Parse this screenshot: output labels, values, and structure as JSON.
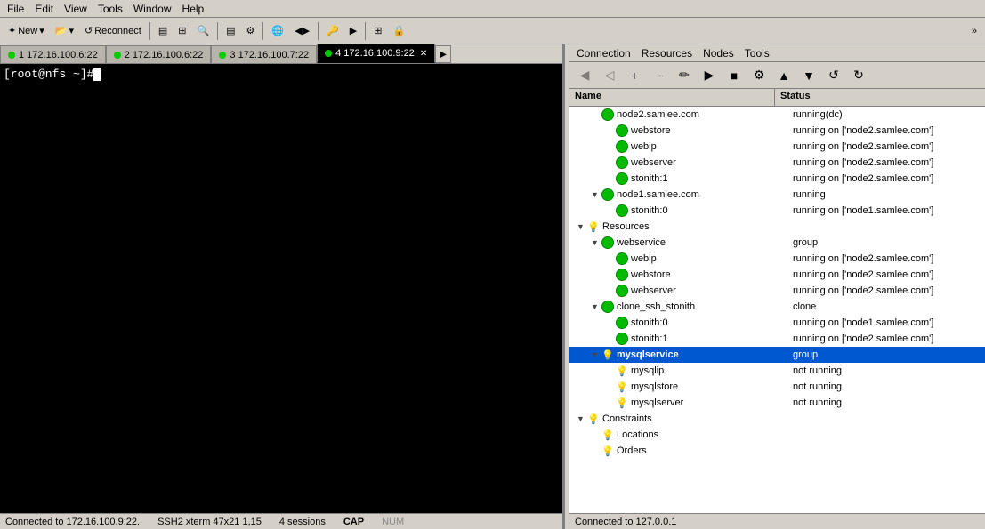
{
  "menubar": {
    "items": [
      "File",
      "Edit",
      "View",
      "Tools",
      "Window",
      "Help"
    ]
  },
  "toolbar": {
    "new_label": "New",
    "reconnect_label": "Reconnect"
  },
  "tabs": [
    {
      "id": 1,
      "label": "172.16.100.6:22",
      "active": false
    },
    {
      "id": 2,
      "label": "172.16.100.6:22",
      "active": false
    },
    {
      "id": 3,
      "label": "172.16.100.7:22",
      "active": false
    },
    {
      "id": 4,
      "label": "172.16.100.9:22",
      "active": true
    }
  ],
  "terminal": {
    "prompt": "[root@nfs ~]# "
  },
  "status_bar": {
    "connection": "Connected to 172.16.100.9:22.",
    "ssh_info": "SSH2  xterm  47x21  1,15",
    "sessions": "4 sessions",
    "cap": "CAP",
    "num": "NUM"
  },
  "cluster_menu": {
    "items": [
      "Connection",
      "Resources",
      "Nodes",
      "Tools"
    ]
  },
  "tree_headers": {
    "name": "Name",
    "status": "Status"
  },
  "tree_rows": [
    {
      "indent": 3,
      "icon": "green-circle",
      "expand": false,
      "name": "node2.samlee.com",
      "status": "running(dc)",
      "selected": false
    },
    {
      "indent": 4,
      "icon": "green-circle",
      "expand": false,
      "name": "webstore",
      "status": "running on ['node2.samlee.com']",
      "selected": false
    },
    {
      "indent": 4,
      "icon": "green-circle",
      "expand": false,
      "name": "webip",
      "status": "running on ['node2.samlee.com']",
      "selected": false
    },
    {
      "indent": 4,
      "icon": "green-circle",
      "expand": false,
      "name": "webserver",
      "status": "running on ['node2.samlee.com']",
      "selected": false
    },
    {
      "indent": 4,
      "icon": "green-circle",
      "expand": false,
      "name": "stonith:1",
      "status": "running on ['node2.samlee.com']",
      "selected": false
    },
    {
      "indent": 3,
      "icon": "green-circle",
      "expand": true,
      "name": "node1.samlee.com",
      "status": "running",
      "selected": false
    },
    {
      "indent": 4,
      "icon": "green-circle",
      "expand": false,
      "name": "stonith:0",
      "status": "running on ['node1.samlee.com']",
      "selected": false
    },
    {
      "indent": 2,
      "icon": "lightbulb",
      "expand": true,
      "name": "Resources",
      "status": "",
      "selected": false
    },
    {
      "indent": 3,
      "icon": "green-circle",
      "expand": true,
      "name": "webservice",
      "status": "group",
      "selected": false
    },
    {
      "indent": 4,
      "icon": "green-circle",
      "expand": false,
      "name": "webip",
      "status": "running on ['node2.samlee.com']",
      "selected": false
    },
    {
      "indent": 4,
      "icon": "green-circle",
      "expand": false,
      "name": "webstore",
      "status": "running on ['node2.samlee.com']",
      "selected": false
    },
    {
      "indent": 4,
      "icon": "green-circle",
      "expand": false,
      "name": "webserver",
      "status": "running on ['node2.samlee.com']",
      "selected": false
    },
    {
      "indent": 3,
      "icon": "green-circle",
      "expand": true,
      "name": "clone_ssh_stonith",
      "status": "clone",
      "selected": false
    },
    {
      "indent": 4,
      "icon": "green-circle",
      "expand": false,
      "name": "stonith:0",
      "status": "running on ['node1.samlee.com']",
      "selected": false
    },
    {
      "indent": 4,
      "icon": "green-circle",
      "expand": false,
      "name": "stonith:1",
      "status": "running on ['node2.samlee.com']",
      "selected": false
    },
    {
      "indent": 3,
      "icon": "lightbulb",
      "expand": true,
      "name": "mysqlservice",
      "status": "group",
      "selected": true
    },
    {
      "indent": 4,
      "icon": "lightbulb",
      "expand": false,
      "name": "mysqlip",
      "status": "not running",
      "selected": false
    },
    {
      "indent": 4,
      "icon": "lightbulb",
      "expand": false,
      "name": "mysqlstore",
      "status": "not running",
      "selected": false
    },
    {
      "indent": 4,
      "icon": "lightbulb",
      "expand": false,
      "name": "mysqlserver",
      "status": "not running",
      "selected": false
    },
    {
      "indent": 2,
      "icon": "lightbulb",
      "expand": true,
      "name": "Constraints",
      "status": "",
      "selected": false
    },
    {
      "indent": 3,
      "icon": "lightbulb",
      "expand": false,
      "name": "Locations",
      "status": "",
      "selected": false
    },
    {
      "indent": 3,
      "icon": "lightbulb",
      "expand": false,
      "name": "Orders",
      "status": "",
      "selected": false
    }
  ],
  "cluster_status": {
    "text": "Connected to 127.0.0.1"
  }
}
